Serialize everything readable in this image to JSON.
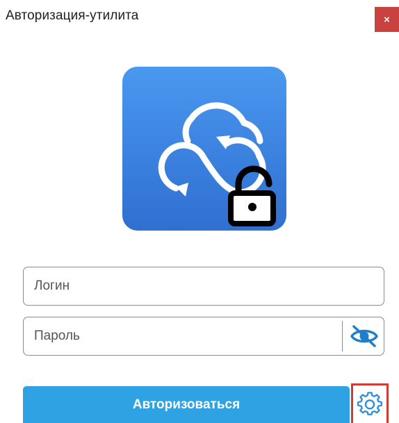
{
  "window": {
    "title": "Авторизация-утилита",
    "close_label": "×"
  },
  "logo": {
    "icon": "cloud-sync-lock-icon",
    "background_gradient": [
      "#4a98f0",
      "#2f6fd0"
    ]
  },
  "form": {
    "login_placeholder": "Логин",
    "password_placeholder": "Пароль",
    "password_visibility_icon": "eye-slash-icon",
    "submit_label": "Авторизоваться",
    "settings_icon": "gear-icon"
  },
  "colors": {
    "submit_button": "#2fa2e3",
    "close_button": "#c8423f",
    "settings_highlight": "#d23b35",
    "eye_icon": "#1f7fc8"
  }
}
